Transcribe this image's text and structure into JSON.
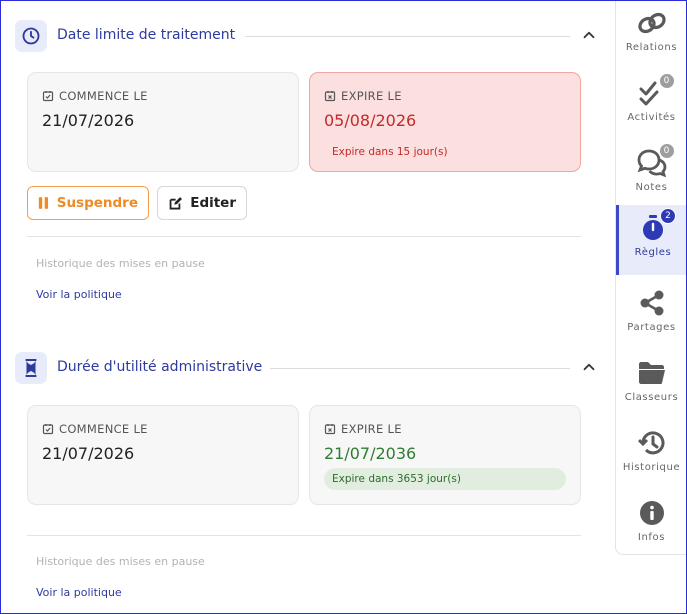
{
  "sections": [
    {
      "title": "Date limite de traitement",
      "start": {
        "label": "COMMENCE LE",
        "value": "21/07/2026"
      },
      "end": {
        "label": "EXPIRE LE",
        "value": "05/08/2026",
        "note": "Expire dans 15 jour(s)"
      },
      "buttons": {
        "suspend": "Suspendre",
        "edit": "Editer"
      },
      "history": "Historique des mises en pause",
      "policy_link": "Voir la politique"
    },
    {
      "title": "Durée d'utilité administrative",
      "start": {
        "label": "COMMENCE LE",
        "value": "21/07/2026"
      },
      "end": {
        "label": "EXPIRE LE",
        "value": "21/07/2036",
        "note": "Expire dans 3653 jour(s)"
      },
      "history": "Historique des mises en pause",
      "policy_link": "Voir la politique"
    }
  ],
  "sidebar": {
    "items": [
      {
        "label": "Relations",
        "icon": "link-icon"
      },
      {
        "label": "Activités",
        "icon": "double-check-icon",
        "badge": "0"
      },
      {
        "label": "Notes",
        "icon": "chat-bubbles-icon",
        "badge": "0"
      },
      {
        "label": "Règles",
        "icon": "stopwatch-icon",
        "badge": "2",
        "active": true
      },
      {
        "label": "Partages",
        "icon": "share-icon"
      },
      {
        "label": "Classeurs",
        "icon": "folder-icon"
      },
      {
        "label": "Historique",
        "icon": "history-icon"
      },
      {
        "label": "Infos",
        "icon": "info-icon"
      }
    ]
  },
  "colors": {
    "accent": "#2e3a9e",
    "danger": "#c62828",
    "success": "#2e7d32",
    "warning": "#f08a24"
  }
}
